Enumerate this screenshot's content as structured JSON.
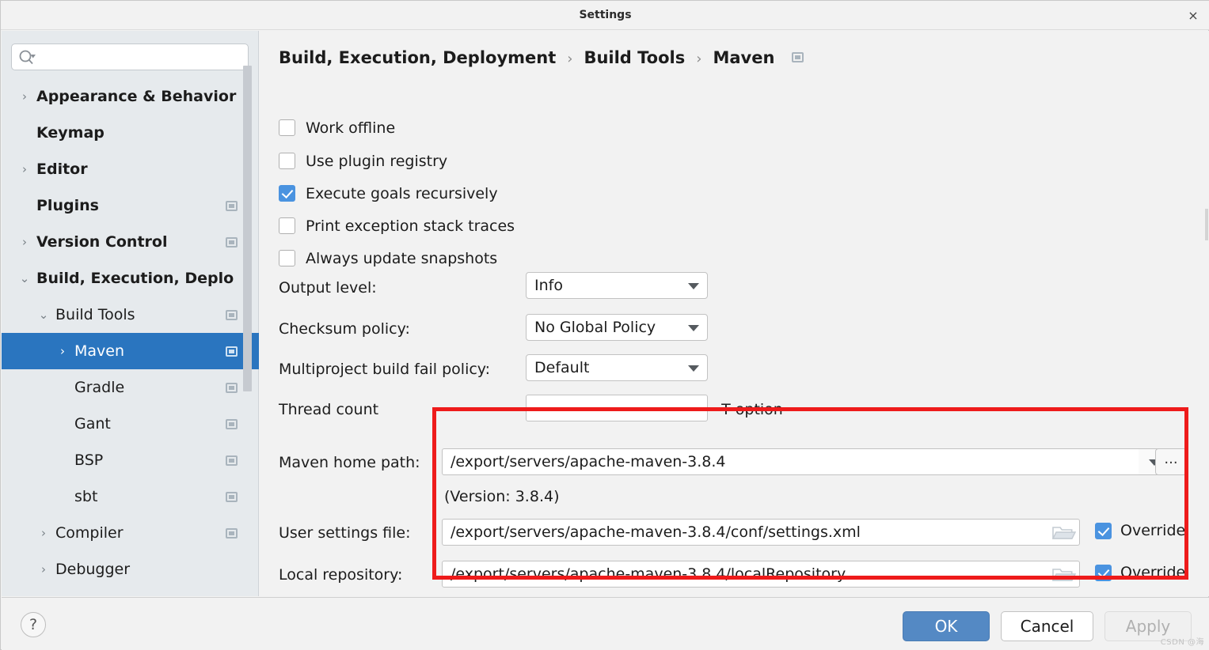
{
  "window": {
    "title": "Settings",
    "close_label": "×"
  },
  "sidebar": {
    "search": {
      "value": "",
      "placeholder": "",
      "icon": "search-icon"
    },
    "items": [
      {
        "label": "Appearance & Behavior",
        "arrow": "›",
        "level": 0,
        "bold": true,
        "badge": false,
        "selected": false
      },
      {
        "label": "Keymap",
        "arrow": "",
        "level": 0,
        "bold": true,
        "badge": false,
        "selected": false
      },
      {
        "label": "Editor",
        "arrow": "›",
        "level": 0,
        "bold": true,
        "badge": false,
        "selected": false
      },
      {
        "label": "Plugins",
        "arrow": "",
        "level": 0,
        "bold": true,
        "badge": true,
        "selected": false
      },
      {
        "label": "Version Control",
        "arrow": "›",
        "level": 0,
        "bold": true,
        "badge": true,
        "selected": false
      },
      {
        "label": "Build, Execution, Deplo",
        "arrow": "⌄",
        "level": 0,
        "bold": true,
        "badge": false,
        "selected": false
      },
      {
        "label": "Build Tools",
        "arrow": "⌄",
        "level": 1,
        "bold": false,
        "badge": true,
        "selected": false
      },
      {
        "label": "Maven",
        "arrow": "›",
        "level": 2,
        "bold": false,
        "badge": true,
        "selected": true
      },
      {
        "label": "Gradle",
        "arrow": "",
        "level": 2,
        "bold": false,
        "badge": true,
        "selected": false
      },
      {
        "label": "Gant",
        "arrow": "",
        "level": 2,
        "bold": false,
        "badge": true,
        "selected": false
      },
      {
        "label": "BSP",
        "arrow": "",
        "level": 2,
        "bold": false,
        "badge": true,
        "selected": false
      },
      {
        "label": "sbt",
        "arrow": "",
        "level": 2,
        "bold": false,
        "badge": true,
        "selected": false
      },
      {
        "label": "Compiler",
        "arrow": "›",
        "level": 1,
        "bold": false,
        "badge": true,
        "selected": false
      },
      {
        "label": "Debugger",
        "arrow": "›",
        "level": 1,
        "bold": false,
        "badge": false,
        "selected": false
      }
    ]
  },
  "breadcrumb": {
    "parts": [
      "Build, Execution, Deployment",
      "Build Tools",
      "Maven"
    ],
    "separator": "›"
  },
  "main": {
    "checkboxes": [
      {
        "label": "Work offline",
        "checked": false
      },
      {
        "label": "Use plugin registry",
        "checked": false
      },
      {
        "label": "Execute goals recursively",
        "checked": true
      },
      {
        "label": "Print exception stack traces",
        "checked": false
      },
      {
        "label": "Always update snapshots",
        "checked": false
      }
    ],
    "output_level": {
      "label": "Output level:",
      "value": "Info"
    },
    "checksum_policy": {
      "label": "Checksum policy:",
      "value": "No Global Policy"
    },
    "multiproject": {
      "label": "Multiproject build fail policy:",
      "value": "Default"
    },
    "thread_count": {
      "label": "Thread count",
      "value": "",
      "hint": "-T option"
    },
    "maven_home": {
      "label": "Maven home path:",
      "value": "/export/servers/apache-maven-3.8.4",
      "ellipsis_label": "..."
    },
    "version_note": "(Version: 3.8.4)",
    "user_settings": {
      "label": "User settings file:",
      "value": "/export/servers/apache-maven-3.8.4/conf/settings.xml",
      "override_label": "Override",
      "override": true
    },
    "local_repo": {
      "label": "Local repository:",
      "value": "/export/servers/apache-maven-3.8.4/localRepository",
      "override_label": "Override",
      "override": true
    }
  },
  "footer": {
    "help_label": "?",
    "ok_label": "OK",
    "cancel_label": "Cancel",
    "apply_label": "Apply",
    "watermark": "CSDN @海"
  },
  "colors": {
    "selection_blue": "#2a75bf",
    "checkbox_blue": "#4a93e0",
    "highlight_red": "#ee1b1b",
    "ok_button": "#5489c4",
    "sidebar_bg": "#e6eaed",
    "panel_bg": "#f2f2f2"
  }
}
